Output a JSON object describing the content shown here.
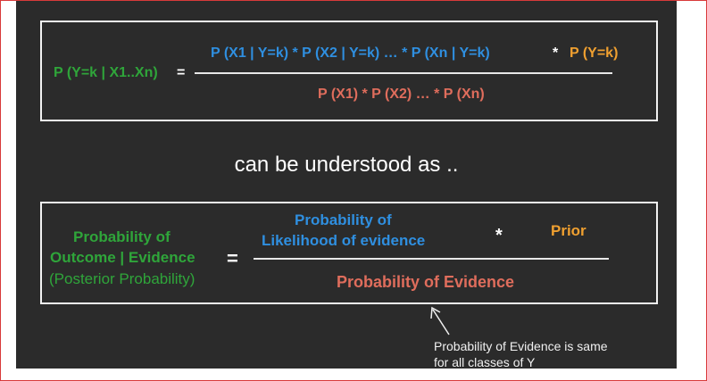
{
  "top_formula": {
    "lhs": "P (Y=k | X1..Xn)",
    "equals": "=",
    "numerator_likelihood": "P (X1 | Y=k) * P (X2 | Y=k) … * P (Xn | Y=k)",
    "times": "*",
    "numerator_prior": "P (Y=k)",
    "denominator": "P (X1) * P (X2) … * P (Xn)"
  },
  "middle_text": "can be understood as ..",
  "bottom_formula": {
    "lhs_line1": "Probability of",
    "lhs_line2": "Outcome | Evidence",
    "lhs_line3": "(Posterior Probability)",
    "equals": "=",
    "likelihood_line1": "Probability of",
    "likelihood_line2": "Likelihood of evidence",
    "times": "*",
    "prior": "Prior",
    "denominator": "Probability of Evidence"
  },
  "annotation": {
    "line1": "Probability of Evidence is same",
    "line2": "for all classes of Y"
  },
  "colors": {
    "background": "#2b2b2b",
    "green": "#2fa53a",
    "blue": "#2f8fe0",
    "orange": "#f0a030",
    "red": "#df6d5c"
  }
}
